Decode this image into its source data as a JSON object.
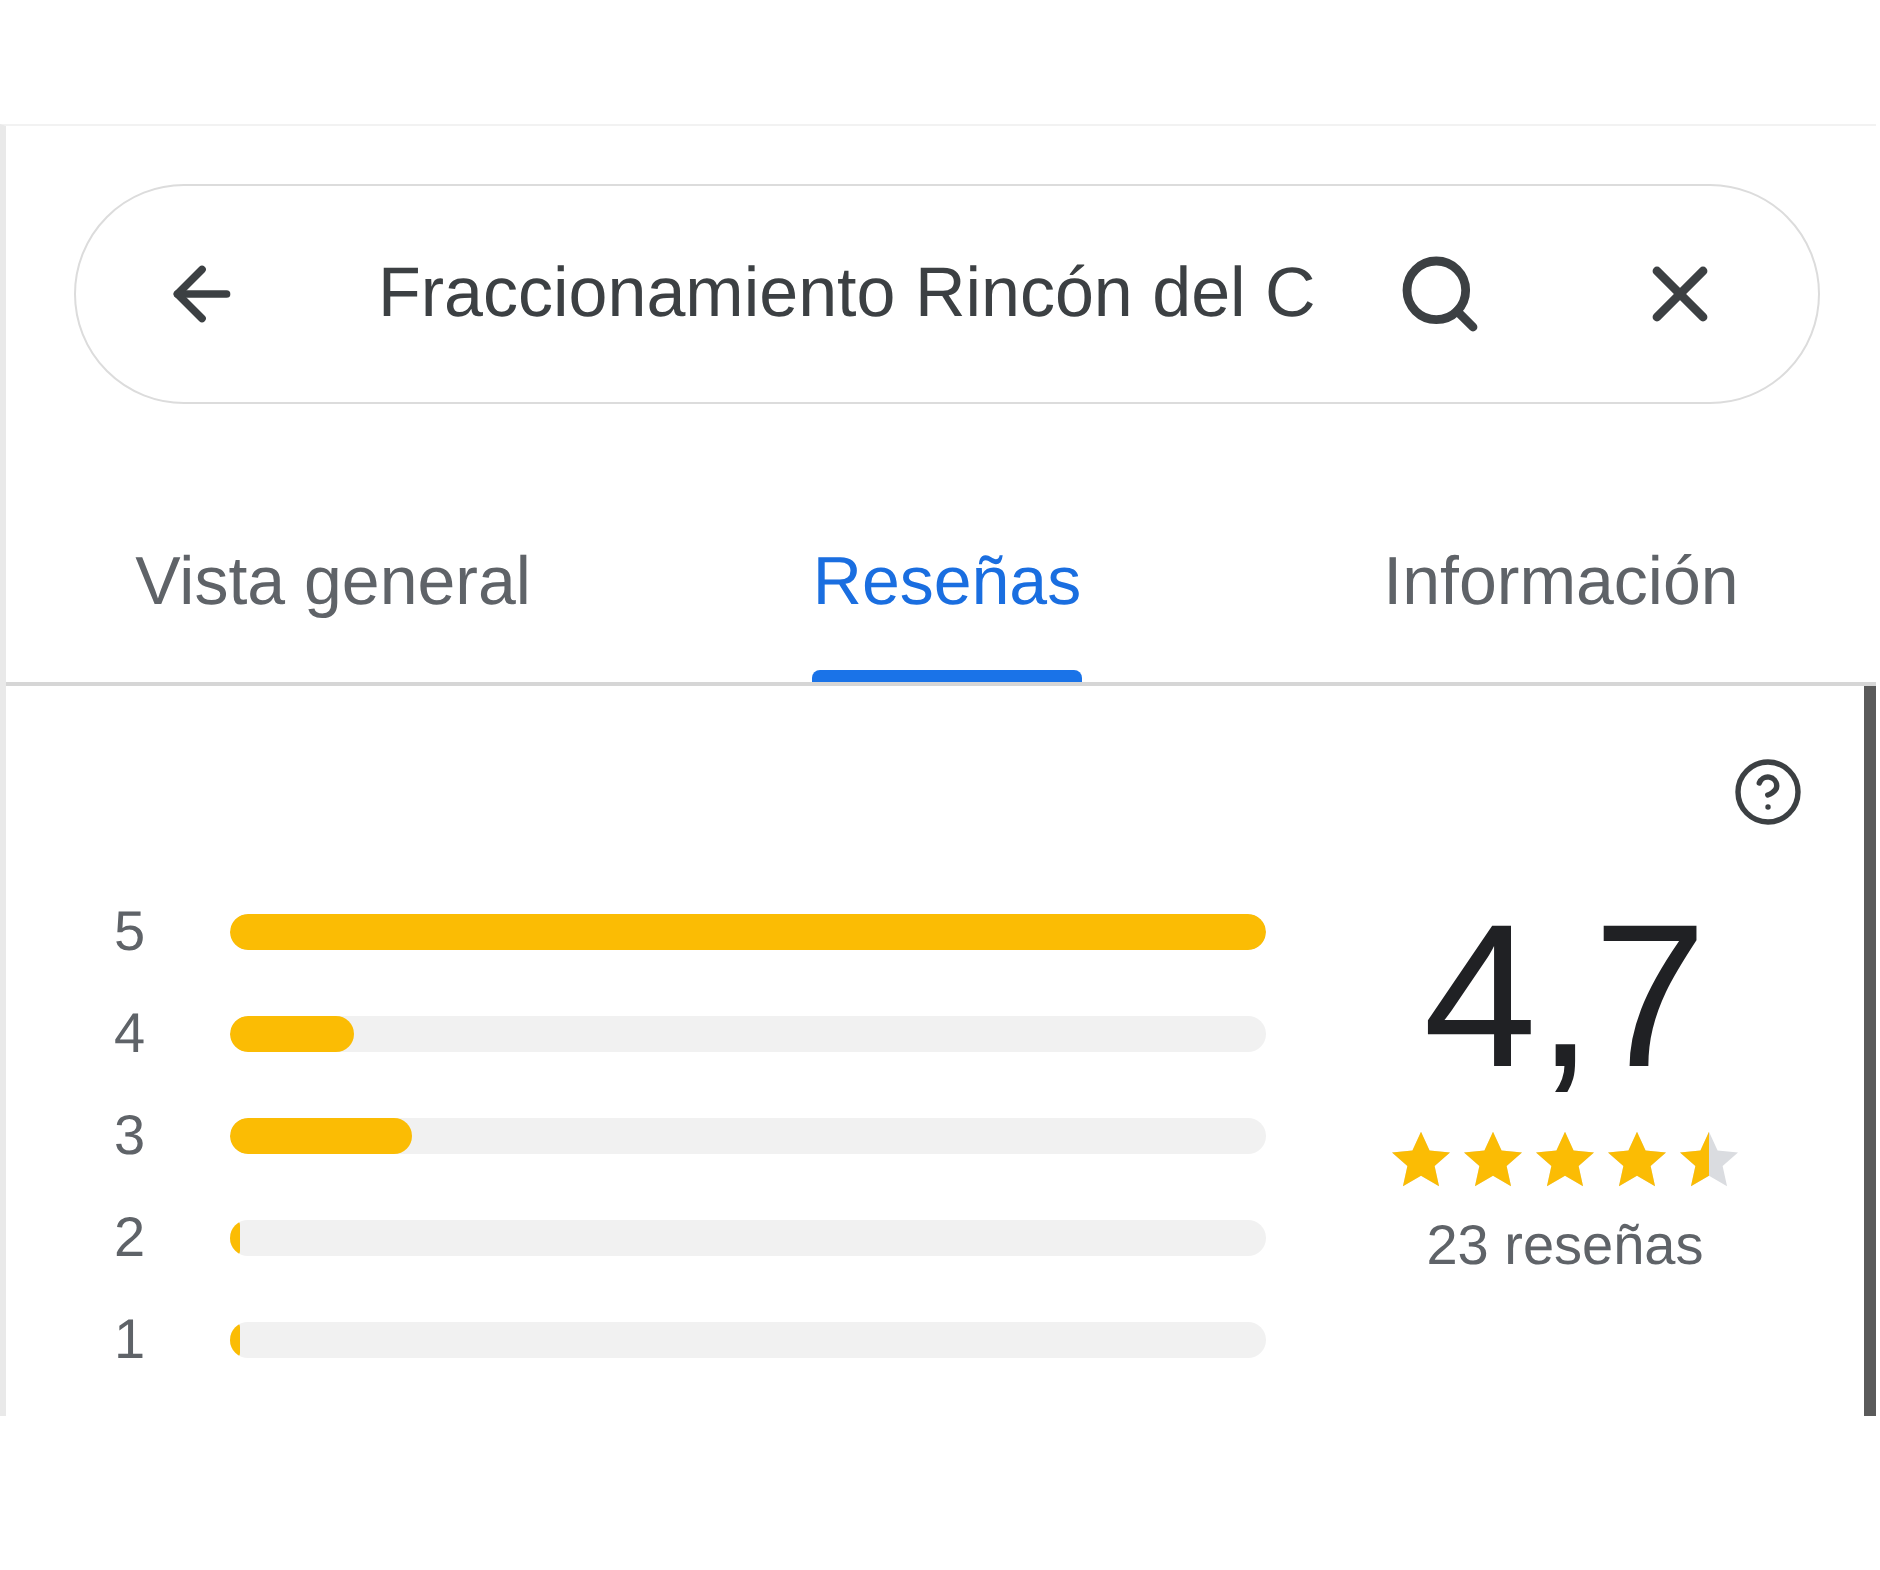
{
  "search": {
    "value": "Fraccionamiento Rincón del C"
  },
  "tabs": [
    {
      "label": "Vista general",
      "selected": false
    },
    {
      "label": "Reseñas",
      "selected": true
    },
    {
      "label": "Información",
      "selected": false
    }
  ],
  "ratings": {
    "histogram": [
      {
        "label": "5",
        "level": 1
      },
      {
        "label": "4",
        "level": 0.12
      },
      {
        "label": "3",
        "level": 0.175
      },
      {
        "label": "2",
        "level": 0.01
      },
      {
        "label": "1",
        "level": 0.01
      }
    ],
    "score": "4,7",
    "stars": 4.5,
    "count": "23 reseñas"
  }
}
